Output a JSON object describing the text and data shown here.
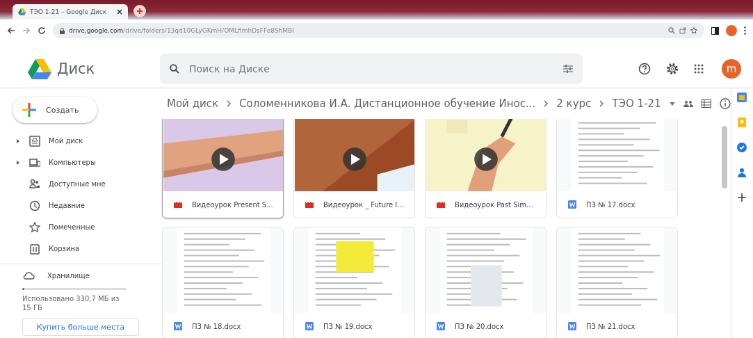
{
  "browser": {
    "tab": {
      "title": "ТЭО 1-21 – Google Диск"
    },
    "url": {
      "host": "drive.google.com",
      "path": "/drive/folders/13qd10GLyGKmH/OMLfimhDsFFe8ShMBI"
    }
  },
  "app": {
    "name": "Диск",
    "search": {
      "placeholder": "Поиск на Диске"
    },
    "avatar": "m"
  },
  "sidebar": {
    "create": "Создать",
    "items": [
      {
        "label": "Мой диск",
        "kind": "drive",
        "expandable": true
      },
      {
        "label": "Компьютеры",
        "kind": "computer",
        "expandable": true
      },
      {
        "label": "Доступные мне",
        "kind": "shared",
        "expandable": false
      },
      {
        "label": "Недавние",
        "kind": "recent",
        "expandable": false
      },
      {
        "label": "Помеченные",
        "kind": "starred",
        "expandable": false
      },
      {
        "label": "Корзина",
        "kind": "trash",
        "expandable": false
      }
    ],
    "storage": {
      "label": "Хранилище",
      "level": 0.02,
      "usage": "Использовано 330,7 МБ из 15 ГБ",
      "button": "Купить больше места"
    }
  },
  "breadcrumbs": [
    "Мой диск",
    "Соломенникова И.А. Дистанционное обучение Инос...",
    "2 курс",
    "ТЭО 1-21"
  ],
  "files": [
    {
      "name": "Видеоурок Present S...",
      "kind": "video",
      "selected": true
    },
    {
      "name": "Видеоурок _ Future I...",
      "kind": "video",
      "selected": false
    },
    {
      "name": "Видеоурок Past Sim...",
      "kind": "video",
      "selected": false
    },
    {
      "name": "ПЗ № 17.docx",
      "kind": "doc",
      "selected": false
    },
    {
      "name": "ПЗ № 18.docx",
      "kind": "doc",
      "selected": false
    },
    {
      "name": "ПЗ № 19.docx",
      "kind": "doc",
      "selected": false
    },
    {
      "name": "ПЗ № 20.docx",
      "kind": "doc",
      "selected": false
    },
    {
      "name": "ПЗ № 21.docx",
      "kind": "doc",
      "selected": false
    }
  ]
}
